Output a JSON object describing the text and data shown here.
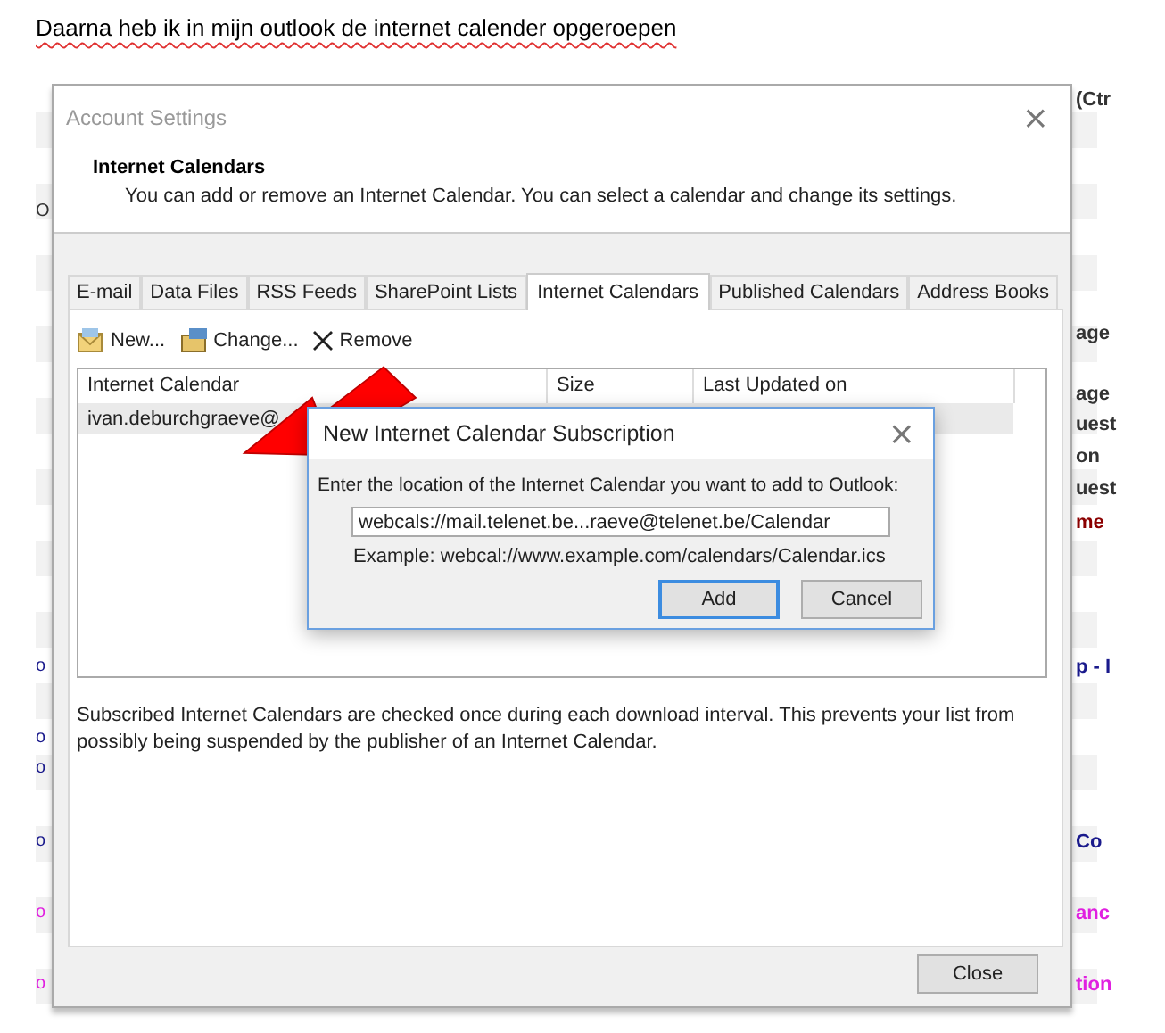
{
  "caption": "Daarna heb ik in mijn outlook de internet calender opgeroepen",
  "left_fragments": [
    {
      "text": "O",
      "color": "#333333"
    },
    {
      "text": "o",
      "color": "#1a1a8c"
    },
    {
      "text": "o",
      "color": "#1a1a8c"
    },
    {
      "text": "o",
      "color": "#1a1a8c"
    },
    {
      "text": "o",
      "color": "#1a1a8c"
    },
    {
      "text": "o",
      "color": "#e020e0"
    },
    {
      "text": "o",
      "color": "#e020e0"
    }
  ],
  "right_fragments": [
    {
      "text": "(Ctr",
      "color": "#333333"
    },
    {
      "text": "age",
      "color": "#333333"
    },
    {
      "text": "age",
      "color": "#333333"
    },
    {
      "text": "uest",
      "color": "#333333"
    },
    {
      "text": "on",
      "color": "#333333"
    },
    {
      "text": "uest",
      "color": "#333333"
    },
    {
      "text": "me",
      "color": "#8b0000"
    },
    {
      "text": "p - I",
      "color": "#1a1a8c"
    },
    {
      "text": "Co",
      "color": "#1a1a8c"
    },
    {
      "text": "anc",
      "color": "#e020e0"
    },
    {
      "text": "tion",
      "color": "#e020e0"
    }
  ],
  "window": {
    "title": "Account Settings",
    "close": "×"
  },
  "header": {
    "title": "Internet Calendars",
    "description": "You can add or remove an Internet Calendar. You can select a calendar and change its settings."
  },
  "tabs": [
    {
      "label": "E-mail",
      "selected": false
    },
    {
      "label": "Data Files",
      "selected": false
    },
    {
      "label": "RSS Feeds",
      "selected": false
    },
    {
      "label": "SharePoint Lists",
      "selected": false
    },
    {
      "label": "Internet Calendars",
      "selected": true
    },
    {
      "label": "Published Calendars",
      "selected": false
    },
    {
      "label": "Address Books",
      "selected": false
    }
  ],
  "toolbar": [
    {
      "kind": "new",
      "label": "New..."
    },
    {
      "kind": "change",
      "label": "Change..."
    },
    {
      "kind": "remove",
      "label": "Remove"
    }
  ],
  "table": {
    "columns": [
      "Internet Calendar",
      "Size",
      "Last Updated on"
    ],
    "rows": [
      {
        "cells": [
          "ivan.deburchgraeve@"
        ],
        "selected": true
      }
    ]
  },
  "note": "Subscribed Internet Calendars are checked once during each download interval. This prevents your list from possibly being suspended by the publisher of an Internet Calendar.",
  "close_button": "Close",
  "subscription_dialog": {
    "title": "New Internet Calendar Subscription",
    "close": "×",
    "prompt": "Enter the location of the Internet Calendar you want to add to Outlook:",
    "value": "webcals://mail.telenet.be...raeve@telenet.be/Calendar",
    "example": "Example: webcal://www.example.com/calendars/Calendar.ics",
    "buttons": [
      {
        "label": "Add",
        "default": true
      },
      {
        "label": "Cancel",
        "default": false
      }
    ]
  }
}
